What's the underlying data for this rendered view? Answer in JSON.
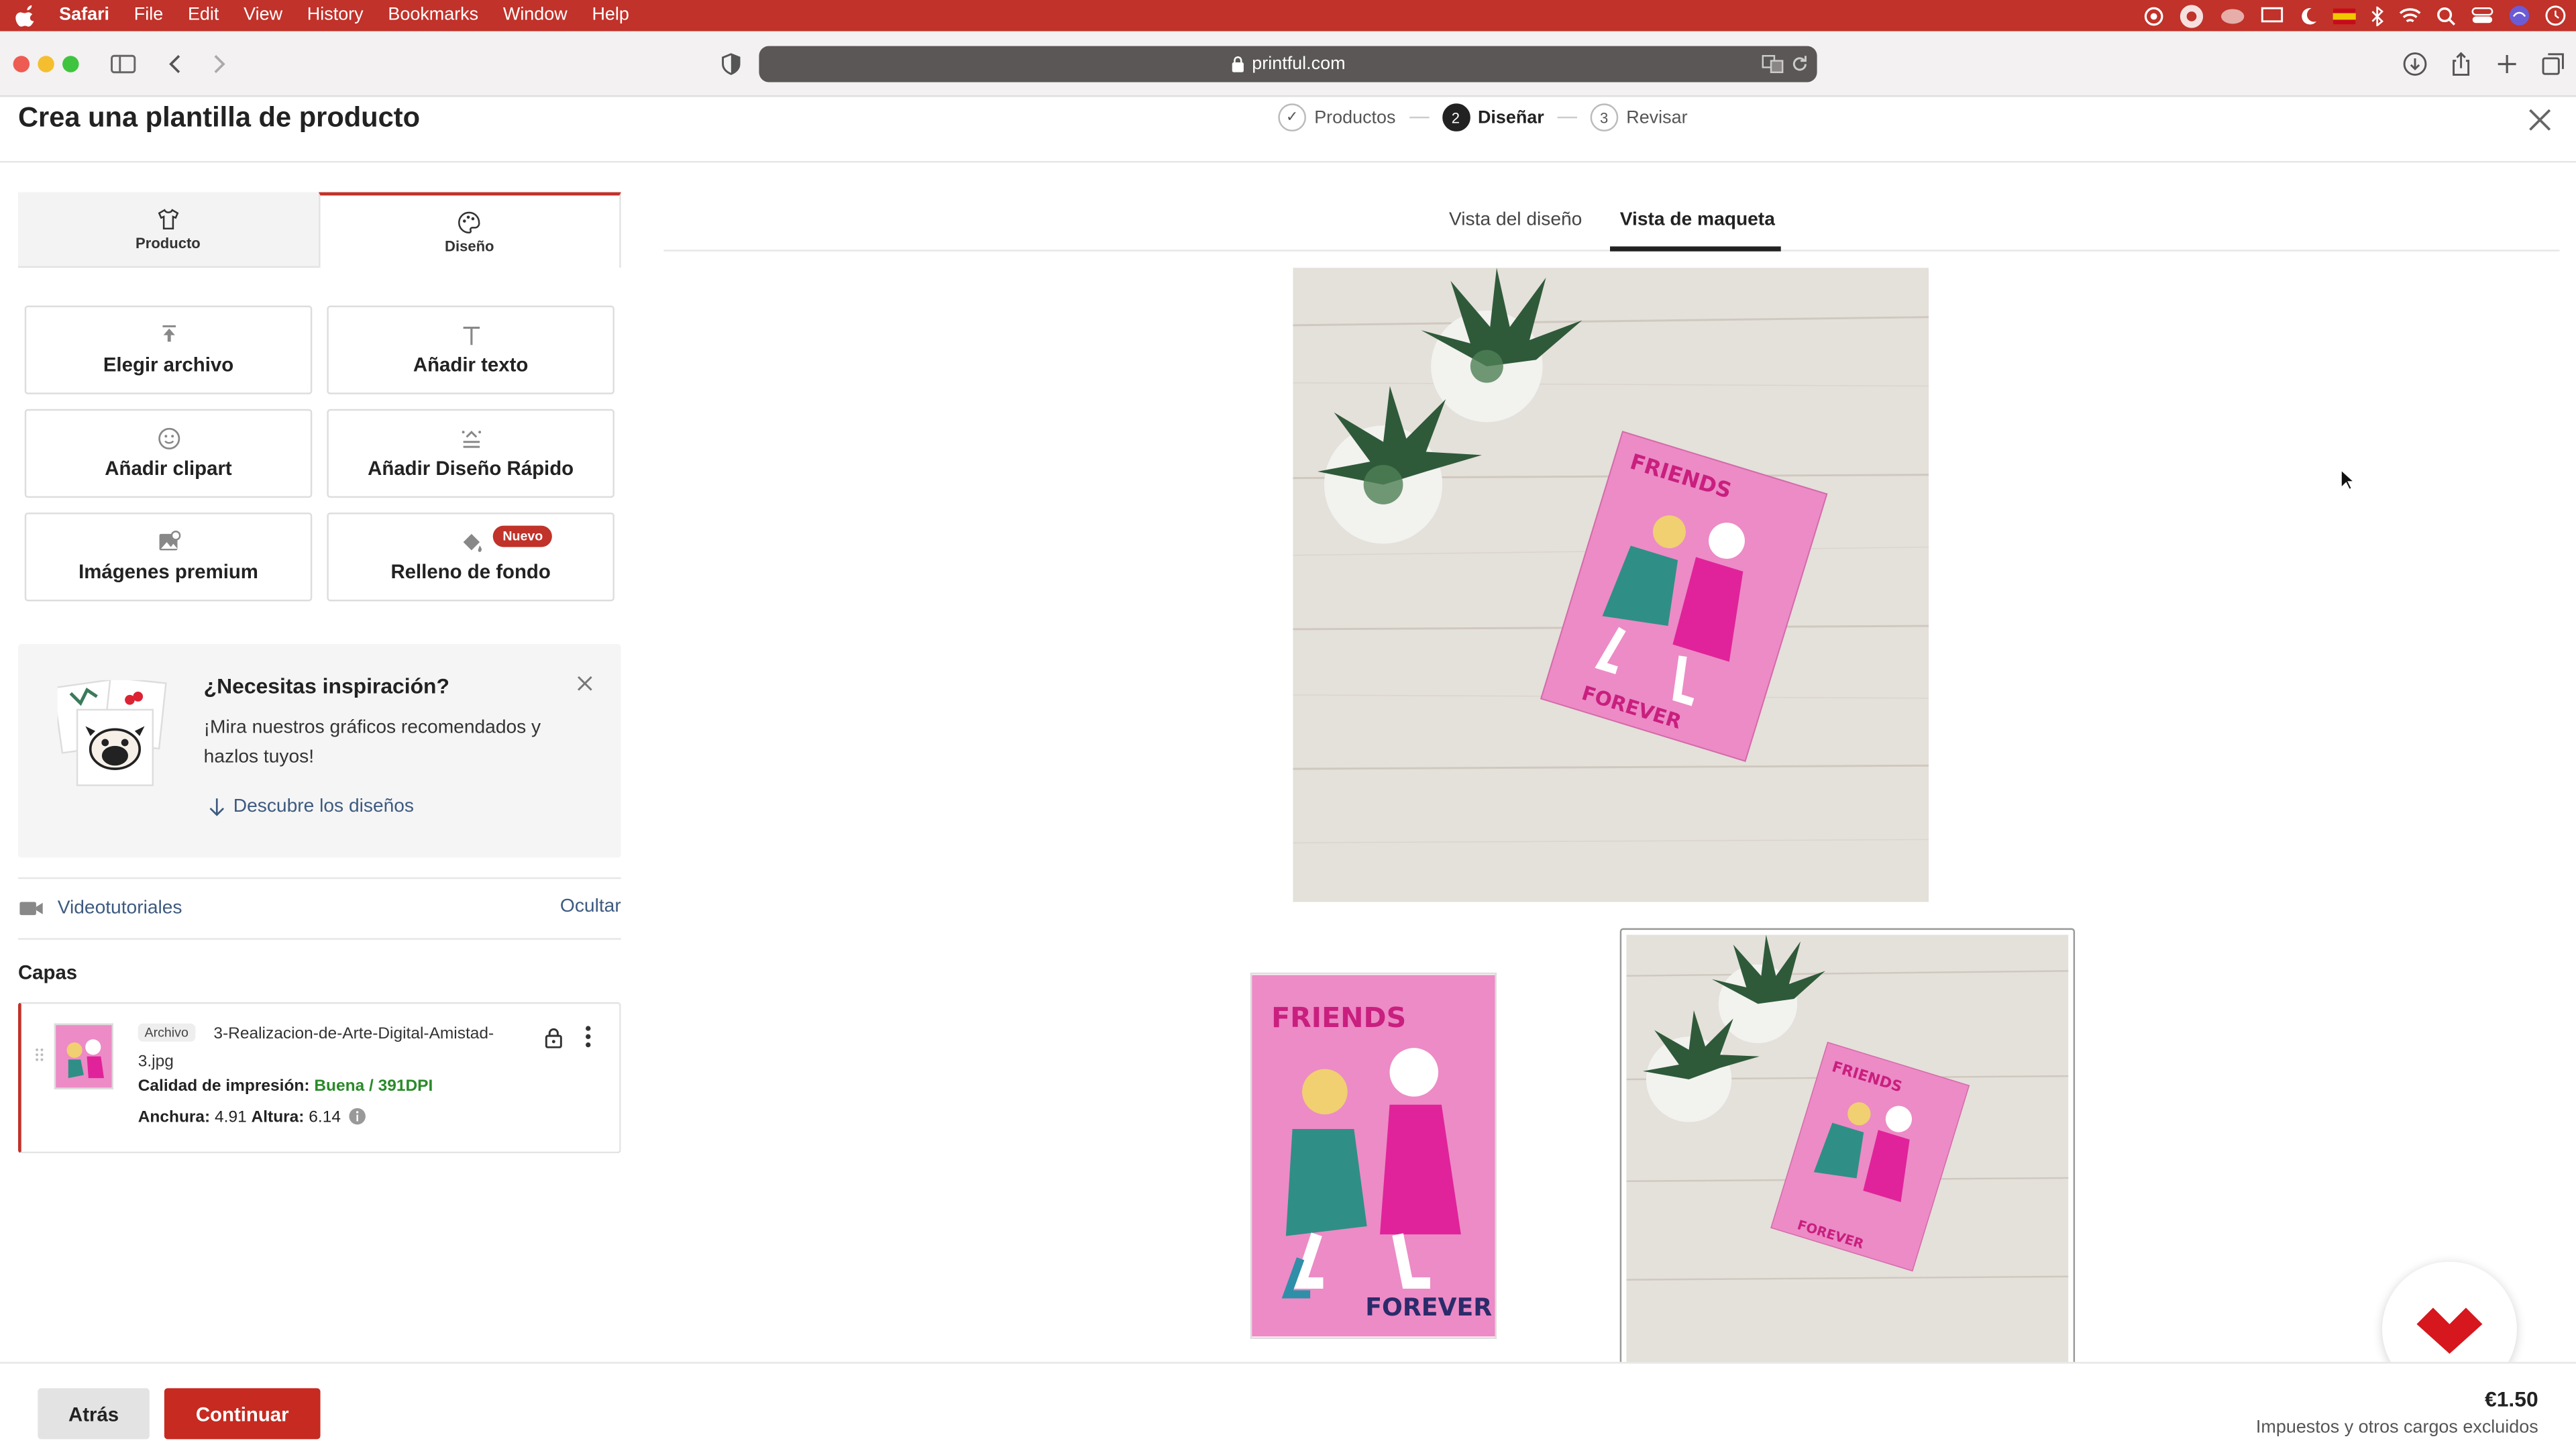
{
  "menubar": {
    "app": "Safari",
    "items": [
      "File",
      "Edit",
      "View",
      "History",
      "Bookmarks",
      "Window",
      "Help"
    ]
  },
  "browser": {
    "url": "printful.com"
  },
  "header": {
    "title": "Crea una plantilla de producto",
    "steps": [
      {
        "number": "✓",
        "label": "Productos"
      },
      {
        "number": "2",
        "label": "Diseñar"
      },
      {
        "number": "3",
        "label": "Revisar"
      }
    ]
  },
  "sidebar": {
    "tabs": [
      {
        "label": "Producto",
        "icon": "tshirt-icon"
      },
      {
        "label": "Diseño",
        "icon": "palette-icon"
      }
    ],
    "tools": [
      {
        "label": "Elegir archivo",
        "icon": "upload-icon"
      },
      {
        "label": "Añadir texto",
        "icon": "text-icon"
      },
      {
        "label": "Añadir clipart",
        "icon": "smiley-icon"
      },
      {
        "label": "Añadir Diseño Rápido",
        "icon": "quick-design-icon"
      },
      {
        "label": "Imágenes premium",
        "icon": "premium-image-icon"
      },
      {
        "label": "Relleno de fondo",
        "icon": "paint-bucket-icon",
        "badge": "Nuevo"
      }
    ],
    "inspiration": {
      "title": "¿Necesitas inspiración?",
      "text": "¡Mira nuestros gráficos recomendados y hazlos tuyos!",
      "link": "Descubre los diseños"
    },
    "video": {
      "label": "Videotutoriales",
      "hide": "Ocultar"
    },
    "layers": {
      "title": "Capas",
      "item": {
        "tag": "Archivo",
        "filename": "3-Realizacion-de-Arte-Digital-Amistad-3.jpg",
        "quality_label": "Calidad de impresión:",
        "quality_value": "Buena / 391DPI",
        "width_label": "Anchura:",
        "width_value": "4.91",
        "height_label": "Altura:",
        "height_value": "6.14"
      }
    }
  },
  "main": {
    "view_tabs": [
      "Vista del diseño",
      "Vista de maqueta"
    ],
    "active_view": "Vista de maqueta",
    "artwork_text_top": "FRIENDS",
    "artwork_text_bottom": "FOREVER"
  },
  "footer": {
    "back_label": "Atrás",
    "continue_label": "Continuar",
    "price": "€1.50",
    "price_note": "Impuestos y otros cargos excluidos"
  },
  "colors": {
    "brand_red": "#c62a20",
    "link_blue": "#3d5a80",
    "good_green": "#2a8a2a",
    "card_pink": "#ec8bc6"
  }
}
